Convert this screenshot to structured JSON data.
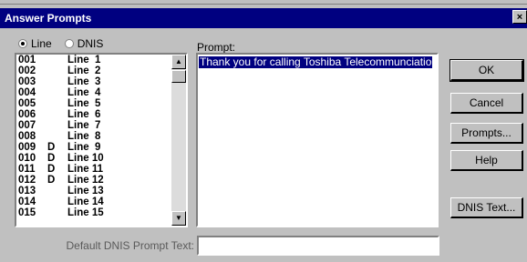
{
  "window": {
    "title": "Answer Prompts",
    "close_glyph": "×"
  },
  "radios": [
    {
      "label": "Line",
      "checked": true
    },
    {
      "label": "DNIS",
      "checked": false
    }
  ],
  "lines": [
    {
      "code": "001",
      "flag": "",
      "name": "Line  1"
    },
    {
      "code": "002",
      "flag": "",
      "name": "Line  2"
    },
    {
      "code": "003",
      "flag": "",
      "name": "Line  3"
    },
    {
      "code": "004",
      "flag": "",
      "name": "Line  4"
    },
    {
      "code": "005",
      "flag": "",
      "name": "Line  5"
    },
    {
      "code": "006",
      "flag": "",
      "name": "Line  6"
    },
    {
      "code": "007",
      "flag": "",
      "name": "Line  7"
    },
    {
      "code": "008",
      "flag": "",
      "name": "Line  8"
    },
    {
      "code": "009",
      "flag": "D",
      "name": "Line  9"
    },
    {
      "code": "010",
      "flag": "D",
      "name": "Line 10"
    },
    {
      "code": "011",
      "flag": "D",
      "name": "Line 11"
    },
    {
      "code": "012",
      "flag": "D",
      "name": "Line 12"
    },
    {
      "code": "013",
      "flag": "",
      "name": "Line 13"
    },
    {
      "code": "014",
      "flag": "",
      "name": "Line 14"
    },
    {
      "code": "015",
      "flag": "",
      "name": "Line 15"
    }
  ],
  "prompt": {
    "label": "Prompt:",
    "selected_text": "Thank you for calling Toshiba Telecommunciatio"
  },
  "buttons": {
    "ok": "OK",
    "cancel": "Cancel",
    "prompts": "Prompts...",
    "help": "Help",
    "dnis_text": "DNIS Text..."
  },
  "footer": {
    "label": "Default DNIS Prompt Text:",
    "value": ""
  },
  "scroll": {
    "up_glyph": "▲",
    "down_glyph": "▼"
  }
}
